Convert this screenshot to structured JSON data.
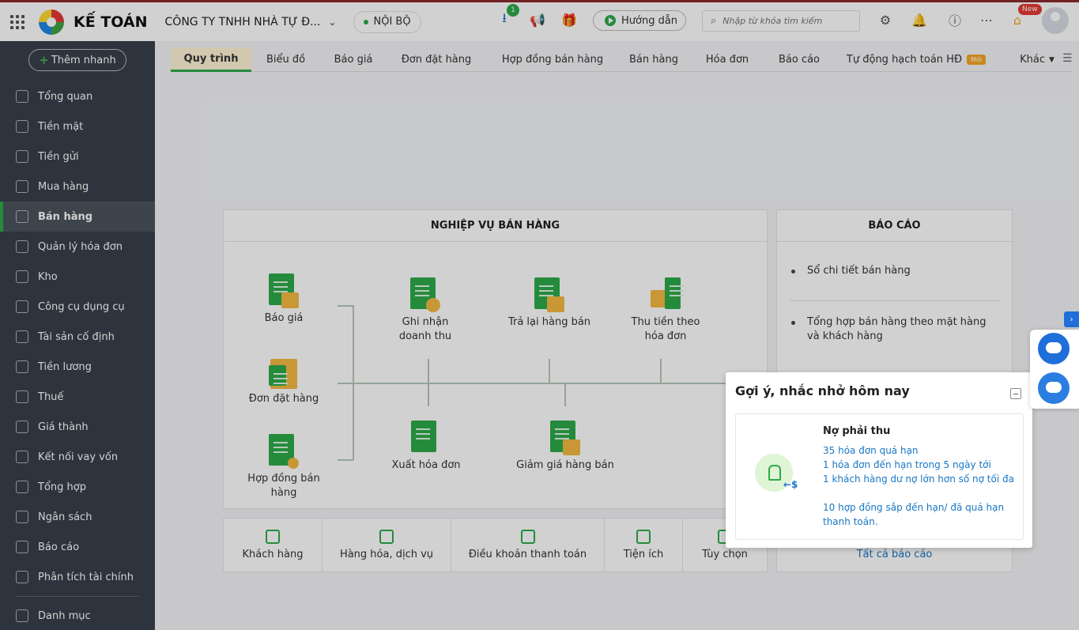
{
  "header": {
    "brand": "KẾ TOÁN",
    "company": "CÔNG TY TNHH NHÀ TỰ Đ...",
    "scope": "NỘI BỘ",
    "download_badge": "1",
    "guide_label": "Hướng dẫn",
    "search_placeholder": "Nhập từ khóa tìm kiếm",
    "new_badge": "New"
  },
  "sidebar": {
    "quick_add": "Thêm nhanh",
    "items": [
      {
        "label": "Tổng quan",
        "icon": "chart-pie-icon"
      },
      {
        "label": "Tiền mặt",
        "icon": "money-bag-icon"
      },
      {
        "label": "Tiền gửi",
        "icon": "bank-icon"
      },
      {
        "label": "Mua hàng",
        "icon": "shopping-bag-icon"
      },
      {
        "label": "Bán hàng",
        "icon": "cart-icon"
      },
      {
        "label": "Quản lý hóa đơn",
        "icon": "invoice-icon"
      },
      {
        "label": "Kho",
        "icon": "warehouse-icon"
      },
      {
        "label": "Công cụ dụng cụ",
        "icon": "tools-icon"
      },
      {
        "label": "Tài sản cố định",
        "icon": "car-icon"
      },
      {
        "label": "Tiền lương",
        "icon": "payroll-icon"
      },
      {
        "label": "Thuế",
        "icon": "tax-icon"
      },
      {
        "label": "Giá thành",
        "icon": "price-tag-icon"
      },
      {
        "label": "Kết nối vay vốn",
        "icon": "loan-icon"
      },
      {
        "label": "Tổng hợp",
        "icon": "summary-icon"
      },
      {
        "label": "Ngân sách",
        "icon": "budget-icon"
      },
      {
        "label": "Báo cáo",
        "icon": "bar-chart-icon"
      },
      {
        "label": "Phân tích tài chính",
        "icon": "analytics-icon"
      },
      {
        "label": "Danh mục",
        "icon": "list-icon"
      }
    ],
    "active_index": 4
  },
  "tabs": [
    {
      "label": "Quy trình"
    },
    {
      "label": "Biểu đồ"
    },
    {
      "label": "Báo giá"
    },
    {
      "label": "Đơn đặt hàng"
    },
    {
      "label": "Hợp đồng bán hàng"
    },
    {
      "label": "Bán hàng"
    },
    {
      "label": "Hóa đơn"
    },
    {
      "label": "Báo cáo"
    },
    {
      "label": "Tự động hạch toán HĐ",
      "badge": "Mới"
    },
    {
      "label": "Khác"
    }
  ],
  "process": {
    "title": "NGHIỆP VỤ BÁN HÀNG",
    "nodes": {
      "quote": "Báo giá",
      "order": "Đơn đặt hàng",
      "contract_1": "Hợp đồng bán",
      "contract_2": "hàng",
      "revenue_1": "Ghi nhận",
      "revenue_2": "doanh thu",
      "return": "Trả lại hàng bán",
      "collect_1": "Thu tiền theo",
      "collect_2": "hóa đơn",
      "invoice": "Xuất hóa đơn",
      "discount": "Giảm giá hàng bán"
    }
  },
  "bottom_links": [
    "Khách hàng",
    "Hàng hóa, dịch vụ",
    "Điều khoản thanh toán",
    "Tiện ích",
    "Tùy chọn"
  ],
  "report": {
    "title": "BÁO CÁO",
    "items": [
      "Sổ chi tiết bán hàng",
      "Tổng hợp bán hàng theo mặt hàng và khách hàng"
    ],
    "all_link": "Tất cả báo cáo"
  },
  "reminder": {
    "title": "Gợi ý, nhắc nhở hôm nay",
    "section": "Nợ phải thu",
    "links": [
      "35 hóa đơn quá hạn",
      "1 hóa đơn đến hạn trong 5 ngày tới",
      "1 khách hàng dư nợ lớn hơn số nợ tối đa",
      "10 hợp đồng sắp đến hạn/ đã quá hạn thanh toán."
    ],
    "arrow": "←$"
  }
}
